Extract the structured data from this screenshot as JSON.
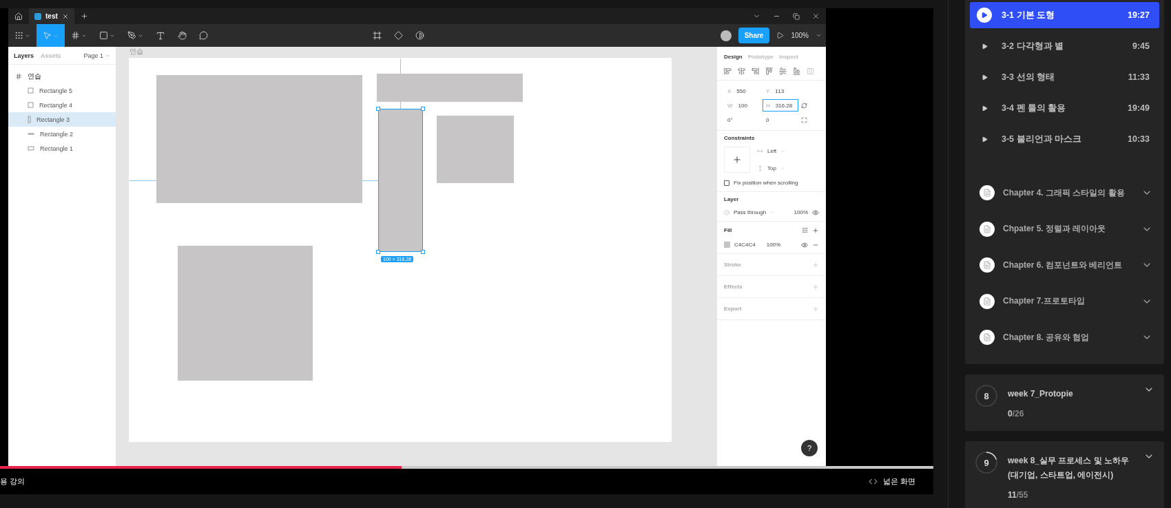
{
  "figma": {
    "tabs": [
      {
        "label": "test",
        "selected": true
      }
    ],
    "toolbar": {
      "share": "Share",
      "zoom": "100%",
      "help": "?"
    },
    "layers_panel": {
      "tabs": [
        {
          "label": "Layers",
          "selected": true
        },
        {
          "label": "Assets",
          "selected": false
        }
      ],
      "page": "Page 1",
      "frame": "연습",
      "layers": [
        {
          "name": "Rectangle 5",
          "kind": "square",
          "selected": false
        },
        {
          "name": "Rectangle 4",
          "kind": "square",
          "selected": false
        },
        {
          "name": "Rectangle 3",
          "kind": "tall",
          "selected": true
        },
        {
          "name": "Rectangle 2",
          "kind": "line",
          "selected": false
        },
        {
          "name": "Rectangle 1",
          "kind": "wide",
          "selected": false
        }
      ]
    },
    "canvas": {
      "frame_label": "연습",
      "selection_size": "100 × 316.28"
    },
    "design_panel": {
      "tabs": [
        {
          "label": "Design",
          "selected": true
        },
        {
          "label": "Prototype",
          "selected": false
        },
        {
          "label": "Inspect",
          "selected": false
        }
      ],
      "fields": [
        {
          "label": "X",
          "value": "550",
          "focused": false
        },
        {
          "label": "Y",
          "value": "113",
          "focused": false
        },
        {
          "label": "W",
          "value": "100",
          "focused": false
        },
        {
          "label": "H",
          "value": "316.28",
          "focused": true
        }
      ],
      "rotation": "0°",
      "radius": "0",
      "constraints": {
        "title": "Constraints",
        "horizontal": "Left",
        "vertical": "Top",
        "fix_label": "Fix position when scrolling",
        "fix_checked": false
      },
      "layer": {
        "title": "Layer",
        "blend": "Pass through",
        "opacity": "100%"
      },
      "fill": {
        "title": "Fill",
        "hex": "C4C4C4",
        "color": "#c4c4c4",
        "opacity": "100%"
      },
      "empty_sections": [
        "Stroke",
        "Effects",
        "Export"
      ]
    }
  },
  "player": {
    "progress": {
      "level": 0.43
    },
    "left_label": "용 강의",
    "wide_button": "넓은 화면"
  },
  "course": {
    "lessons": [
      {
        "title": "3-1 기본 도형",
        "time": "19:27",
        "selected": true
      },
      {
        "title": "3-2 다각형과 별",
        "time": "9:45",
        "selected": false
      },
      {
        "title": "3-3 선의 형태",
        "time": "11:33",
        "selected": false
      },
      {
        "title": "3-4 펜 툴의 활용",
        "time": "19:49",
        "selected": false
      },
      {
        "title": "3-5 불리언과 마스크",
        "time": "10:33",
        "selected": false
      }
    ],
    "chapters": [
      "Chapter 4. 그래픽 스타일의 활용",
      "Chpater 5. 정렬과 레이아웃",
      "Chapter 6. 컴포넌트와 베리언트",
      "Chapter 7.프로토타입",
      "Chapter 8. 공유와 협업"
    ],
    "weeks": [
      {
        "number": "8",
        "title": "week 7_Protopie",
        "done": "0",
        "total": "/26",
        "level": 0
      },
      {
        "number": "9",
        "title": "week 8_실무 프로세스 및 노하우 (대기업, 스타트업, 에이전시)",
        "done": "11",
        "total": "/55",
        "level": 0.2
      }
    ]
  }
}
